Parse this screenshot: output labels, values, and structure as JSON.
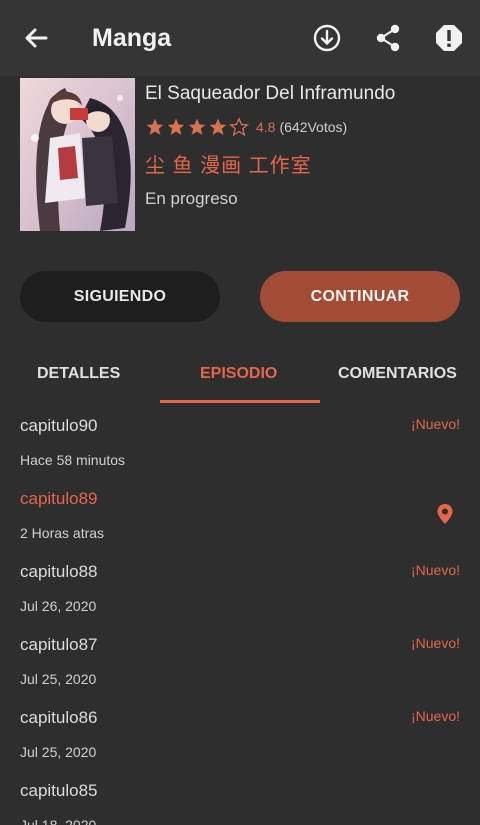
{
  "appbar": {
    "title": "Manga",
    "icons": [
      "back-arrow-icon",
      "download-icon",
      "share-icon",
      "report-icon"
    ]
  },
  "manga": {
    "title": "El Saqueador Del Inframundo",
    "stars_filled": 4,
    "stars_total": 5,
    "rating": "4.8",
    "votes": "(642Votos)",
    "studio": "尘 鱼 漫画 工作室",
    "status": "En progreso"
  },
  "buttons": {
    "follow": "SIGUIENDO",
    "continue": "CONTINUAR"
  },
  "tabs": [
    {
      "label": "DETALLES",
      "active": false
    },
    {
      "label": "EPISODIO",
      "active": true
    },
    {
      "label": "COMENTARIOS",
      "active": false
    }
  ],
  "episodes": [
    {
      "name": "capitulo90",
      "date": "Hace 58 minutos",
      "badge": "¡Nuevo!"
    },
    {
      "name": "capitulo89",
      "date": "2 Horas atras",
      "badge": "",
      "current": true,
      "icon": "location-pin-icon"
    },
    {
      "name": "capitulo88",
      "date": "Jul 26, 2020",
      "badge": "¡Nuevo!"
    },
    {
      "name": "capitulo87",
      "date": "Jul 25, 2020",
      "badge": "¡Nuevo!"
    },
    {
      "name": "capitulo86",
      "date": "Jul 25, 2020",
      "badge": "¡Nuevo!"
    },
    {
      "name": "capitulo85",
      "date": "Jul 18, 2020",
      "badge": ""
    }
  ],
  "colors": {
    "accent": "#e5664a",
    "continue_button": "#a24c35",
    "follow_button": "#1e1e1e",
    "background": "#2e2e2e",
    "appbar": "#353535"
  }
}
